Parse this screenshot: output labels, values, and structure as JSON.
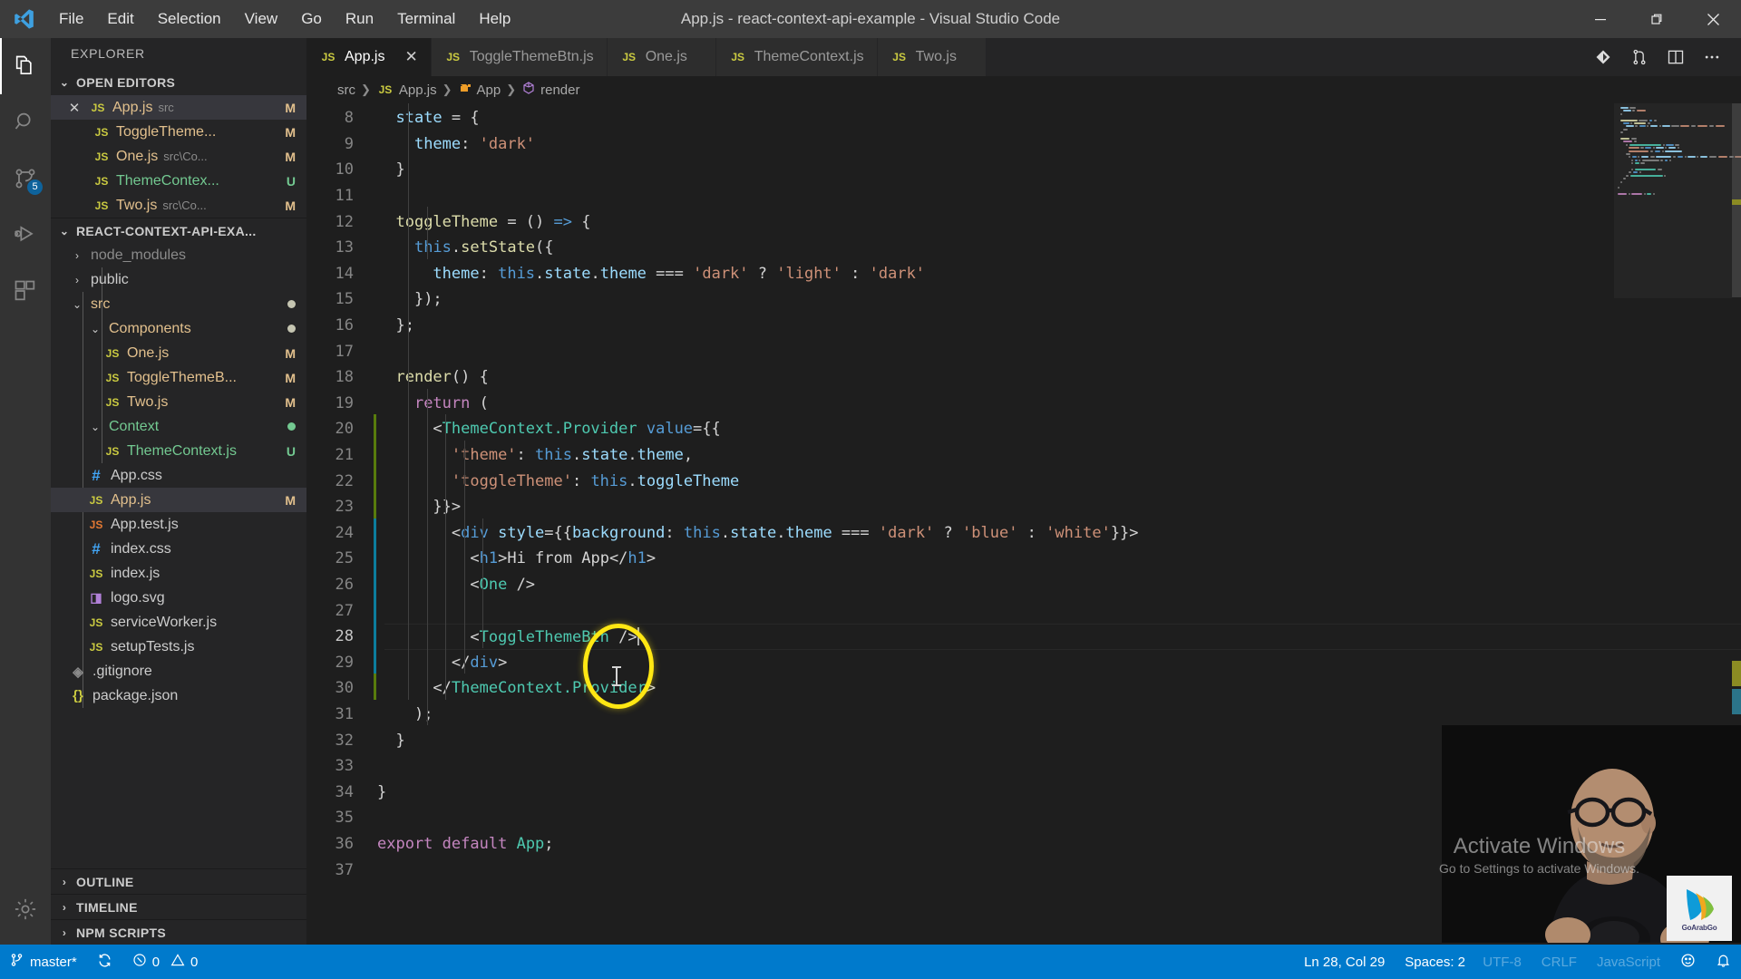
{
  "window": {
    "title": "App.js - react-context-api-example - Visual Studio Code",
    "logo_icon": "vscode-logo-icon",
    "minimize_icon": "minimize-icon",
    "maximize_icon": "maximize-restore-icon",
    "close_icon": "close-icon"
  },
  "menubar": {
    "items": [
      {
        "label": "File"
      },
      {
        "label": "Edit"
      },
      {
        "label": "Selection"
      },
      {
        "label": "View"
      },
      {
        "label": "Go"
      },
      {
        "label": "Run"
      },
      {
        "label": "Terminal"
      },
      {
        "label": "Help"
      }
    ]
  },
  "activitybar": {
    "items": [
      {
        "name": "explorer",
        "icon": "files-icon",
        "active": true,
        "badge": ""
      },
      {
        "name": "search",
        "icon": "search-icon",
        "active": false,
        "badge": ""
      },
      {
        "name": "source-control",
        "icon": "source-control-icon",
        "active": false,
        "badge": "5"
      },
      {
        "name": "run-and-debug",
        "icon": "run-debug-icon",
        "active": false,
        "badge": ""
      },
      {
        "name": "extensions",
        "icon": "extensions-icon",
        "active": false,
        "badge": ""
      }
    ],
    "settings": {
      "name": "manage",
      "icon": "gear-icon"
    }
  },
  "sidebar": {
    "title": "EXPLORER",
    "open_editors": {
      "header": "OPEN EDITORS",
      "expanded": true,
      "items": [
        {
          "icon": "js-file-icon",
          "name": "App.js",
          "path": "src",
          "badge": "M",
          "selected": true,
          "closeable": true,
          "state": "modified"
        },
        {
          "icon": "js-file-icon",
          "name": "ToggleTheme...",
          "path": "",
          "badge": "M",
          "selected": false,
          "closeable": false,
          "state": "modified"
        },
        {
          "icon": "js-file-icon",
          "name": "One.js",
          "path": "src\\Co...",
          "badge": "M",
          "selected": false,
          "closeable": false,
          "state": "modified"
        },
        {
          "icon": "js-file-icon",
          "name": "ThemeContex...",
          "path": "",
          "badge": "U",
          "selected": false,
          "closeable": false,
          "state": "new"
        },
        {
          "icon": "js-file-icon",
          "name": "Two.js",
          "path": "src\\Co...",
          "badge": "M",
          "selected": false,
          "closeable": false,
          "state": "modified"
        }
      ]
    },
    "workspace": {
      "header": "REACT-CONTEXT-API-EXA...",
      "expanded": true,
      "items": [
        {
          "depth": 0,
          "kind": "folder",
          "expanded": false,
          "icon": "chevron-right-icon",
          "name": "node_modules",
          "badge": "",
          "state": "dim"
        },
        {
          "depth": 0,
          "kind": "folder",
          "expanded": false,
          "icon": "chevron-right-icon",
          "name": "public",
          "badge": "",
          "state": ""
        },
        {
          "depth": 0,
          "kind": "folder",
          "expanded": true,
          "icon": "chevron-down-icon",
          "name": "src",
          "badge": "dot",
          "state": "modified"
        },
        {
          "depth": 1,
          "kind": "folder",
          "expanded": true,
          "icon": "chevron-down-icon",
          "name": "Components",
          "badge": "dot",
          "state": "modified"
        },
        {
          "depth": 2,
          "kind": "file",
          "icon": "js-file-icon",
          "name": "One.js",
          "badge": "M",
          "state": "modified"
        },
        {
          "depth": 2,
          "kind": "file",
          "icon": "js-file-icon",
          "name": "ToggleThemeB...",
          "badge": "M",
          "state": "modified"
        },
        {
          "depth": 2,
          "kind": "file",
          "icon": "js-file-icon",
          "name": "Two.js",
          "badge": "M",
          "state": "modified"
        },
        {
          "depth": 1,
          "kind": "folder",
          "expanded": true,
          "icon": "chevron-down-icon",
          "name": "Context",
          "badge": "dot-green",
          "state": "new"
        },
        {
          "depth": 2,
          "kind": "file",
          "icon": "js-file-icon",
          "name": "ThemeContext.js",
          "badge": "U",
          "state": "new"
        },
        {
          "depth": 1,
          "kind": "file",
          "icon": "css-file-icon",
          "name": "App.css",
          "badge": "",
          "state": ""
        },
        {
          "depth": 1,
          "kind": "file",
          "icon": "js-file-icon",
          "name": "App.js",
          "badge": "M",
          "state": "modified",
          "selected": true
        },
        {
          "depth": 1,
          "kind": "file",
          "icon": "js-test-file-icon",
          "name": "App.test.js",
          "badge": "",
          "state": ""
        },
        {
          "depth": 1,
          "kind": "file",
          "icon": "css-file-icon",
          "name": "index.css",
          "badge": "",
          "state": ""
        },
        {
          "depth": 1,
          "kind": "file",
          "icon": "js-file-icon",
          "name": "index.js",
          "badge": "",
          "state": ""
        },
        {
          "depth": 1,
          "kind": "file",
          "icon": "svg-file-icon",
          "name": "logo.svg",
          "badge": "",
          "state": ""
        },
        {
          "depth": 1,
          "kind": "file",
          "icon": "js-file-icon",
          "name": "serviceWorker.js",
          "badge": "",
          "state": ""
        },
        {
          "depth": 1,
          "kind": "file",
          "icon": "js-file-icon",
          "name": "setupTests.js",
          "badge": "",
          "state": ""
        },
        {
          "depth": 0,
          "kind": "file",
          "icon": "git-file-icon",
          "name": ".gitignore",
          "badge": "",
          "state": ""
        },
        {
          "depth": 0,
          "kind": "file",
          "icon": "json-file-icon",
          "name": "package.json",
          "badge": "",
          "state": ""
        }
      ]
    },
    "bottom_panes": [
      {
        "header": "OUTLINE",
        "expanded": false,
        "icon": "chevron-right-icon"
      },
      {
        "header": "TIMELINE",
        "expanded": false,
        "icon": "chevron-right-icon"
      },
      {
        "header": "NPM SCRIPTS",
        "expanded": false,
        "icon": "chevron-right-icon"
      }
    ]
  },
  "editor": {
    "tabs": [
      {
        "icon": "js-file-icon",
        "label": "App.js",
        "active": true,
        "close_icon": "close-icon"
      },
      {
        "icon": "js-file-icon",
        "label": "ToggleThemeBtn.js",
        "active": false,
        "close_icon": ""
      },
      {
        "icon": "js-file-icon",
        "label": "One.js",
        "active": false,
        "close_icon": ""
      },
      {
        "icon": "js-file-icon",
        "label": "ThemeContext.js",
        "active": false,
        "close_icon": ""
      },
      {
        "icon": "js-file-icon",
        "label": "Two.js",
        "active": false,
        "close_icon": ""
      }
    ],
    "actions": [
      {
        "name": "source-control-action",
        "icon": "git-compare-icon"
      },
      {
        "name": "run-file-action",
        "icon": "git-branch-icon"
      },
      {
        "name": "split-editor-action",
        "icon": "split-editor-icon"
      },
      {
        "name": "more-actions",
        "icon": "ellipsis-icon"
      }
    ],
    "breadcrumbs": [
      {
        "icon": "",
        "label": "src"
      },
      {
        "icon": "js-file-icon",
        "label": "App.js"
      },
      {
        "icon": "class-icon",
        "label": "App"
      },
      {
        "icon": "method-icon",
        "label": "render"
      }
    ],
    "first_visible_line": 8,
    "lines": [
      {
        "n": 8,
        "indent": 1,
        "tokens": [
          {
            "t": "state",
            "c": "t-var"
          },
          {
            "t": " = {",
            "c": "t-punc"
          }
        ]
      },
      {
        "n": 9,
        "indent": 2,
        "tokens": [
          {
            "t": "theme",
            "c": "t-prop"
          },
          {
            "t": ": ",
            "c": "t-punc"
          },
          {
            "t": "'dark'",
            "c": "t-str"
          }
        ]
      },
      {
        "n": 10,
        "indent": 1,
        "tokens": [
          {
            "t": "}",
            "c": "t-punc"
          }
        ]
      },
      {
        "n": 11,
        "indent": 0,
        "tokens": []
      },
      {
        "n": 12,
        "indent": 1,
        "tokens": [
          {
            "t": "toggleTheme",
            "c": "t-fn"
          },
          {
            "t": " = () ",
            "c": "t-punc"
          },
          {
            "t": "=>",
            "c": "t-kw2"
          },
          {
            "t": " {",
            "c": "t-punc"
          }
        ]
      },
      {
        "n": 13,
        "indent": 2,
        "tokens": [
          {
            "t": "this",
            "c": "t-this"
          },
          {
            "t": ".",
            "c": "t-punc"
          },
          {
            "t": "setState",
            "c": "t-fn"
          },
          {
            "t": "({",
            "c": "t-punc"
          }
        ]
      },
      {
        "n": 14,
        "indent": 3,
        "tokens": [
          {
            "t": "theme",
            "c": "t-prop"
          },
          {
            "t": ": ",
            "c": "t-punc"
          },
          {
            "t": "this",
            "c": "t-this"
          },
          {
            "t": ".",
            "c": "t-punc"
          },
          {
            "t": "state",
            "c": "t-var"
          },
          {
            "t": ".",
            "c": "t-punc"
          },
          {
            "t": "theme",
            "c": "t-var"
          },
          {
            "t": " === ",
            "c": "t-punc"
          },
          {
            "t": "'dark'",
            "c": "t-str"
          },
          {
            "t": " ? ",
            "c": "t-punc"
          },
          {
            "t": "'light'",
            "c": "t-str"
          },
          {
            "t": " : ",
            "c": "t-punc"
          },
          {
            "t": "'dark'",
            "c": "t-str"
          }
        ]
      },
      {
        "n": 15,
        "indent": 2,
        "tokens": [
          {
            "t": "});",
            "c": "t-punc"
          }
        ]
      },
      {
        "n": 16,
        "indent": 1,
        "tokens": [
          {
            "t": "};",
            "c": "t-punc"
          }
        ]
      },
      {
        "n": 17,
        "indent": 0,
        "tokens": []
      },
      {
        "n": 18,
        "indent": 1,
        "tokens": [
          {
            "t": "render",
            "c": "t-fn"
          },
          {
            "t": "() {",
            "c": "t-punc"
          }
        ]
      },
      {
        "n": 19,
        "indent": 2,
        "tokens": [
          {
            "t": "return",
            "c": "t-kw"
          },
          {
            "t": " (",
            "c": "t-punc"
          }
        ]
      },
      {
        "n": 20,
        "indent": 3,
        "tokens": [
          {
            "t": "<",
            "c": "t-punc"
          },
          {
            "t": "ThemeContext.Provider",
            "c": "t-tag"
          },
          {
            "t": " ",
            "c": "t-punc"
          },
          {
            "t": "value",
            "c": "t-tagb"
          },
          {
            "t": "={{",
            "c": "t-punc"
          }
        ]
      },
      {
        "n": 21,
        "indent": 4,
        "tokens": [
          {
            "t": "'theme'",
            "c": "t-str"
          },
          {
            "t": ": ",
            "c": "t-punc"
          },
          {
            "t": "this",
            "c": "t-this"
          },
          {
            "t": ".",
            "c": "t-punc"
          },
          {
            "t": "state",
            "c": "t-var"
          },
          {
            "t": ".",
            "c": "t-punc"
          },
          {
            "t": "theme",
            "c": "t-var"
          },
          {
            "t": ",",
            "c": "t-punc"
          }
        ]
      },
      {
        "n": 22,
        "indent": 4,
        "tokens": [
          {
            "t": "'toggleTheme'",
            "c": "t-str"
          },
          {
            "t": ": ",
            "c": "t-punc"
          },
          {
            "t": "this",
            "c": "t-this"
          },
          {
            "t": ".",
            "c": "t-punc"
          },
          {
            "t": "toggleTheme",
            "c": "t-var"
          }
        ]
      },
      {
        "n": 23,
        "indent": 3,
        "tokens": [
          {
            "t": "}}>",
            "c": "t-punc"
          }
        ]
      },
      {
        "n": 24,
        "indent": 4,
        "tokens": [
          {
            "t": "<",
            "c": "t-punc"
          },
          {
            "t": "div",
            "c": "t-tagb"
          },
          {
            "t": " ",
            "c": "t-punc"
          },
          {
            "t": "style",
            "c": "t-attr"
          },
          {
            "t": "={{",
            "c": "t-punc"
          },
          {
            "t": "background",
            "c": "t-prop"
          },
          {
            "t": ": ",
            "c": "t-punc"
          },
          {
            "t": "this",
            "c": "t-this"
          },
          {
            "t": ".",
            "c": "t-punc"
          },
          {
            "t": "state",
            "c": "t-var"
          },
          {
            "t": ".",
            "c": "t-punc"
          },
          {
            "t": "theme",
            "c": "t-var"
          },
          {
            "t": " === ",
            "c": "t-punc"
          },
          {
            "t": "'dark'",
            "c": "t-str"
          },
          {
            "t": " ? ",
            "c": "t-punc"
          },
          {
            "t": "'blue'",
            "c": "t-str"
          },
          {
            "t": " : ",
            "c": "t-punc"
          },
          {
            "t": "'white'",
            "c": "t-str"
          },
          {
            "t": "}}>",
            "c": "t-punc"
          }
        ]
      },
      {
        "n": 25,
        "indent": 5,
        "tokens": [
          {
            "t": "<",
            "c": "t-punc"
          },
          {
            "t": "h1",
            "c": "t-tagb"
          },
          {
            "t": ">",
            "c": "t-punc"
          },
          {
            "t": "Hi from App",
            "c": "t-punc"
          },
          {
            "t": "</",
            "c": "t-punc"
          },
          {
            "t": "h1",
            "c": "t-tagb"
          },
          {
            "t": ">",
            "c": "t-punc"
          }
        ]
      },
      {
        "n": 26,
        "indent": 5,
        "tokens": [
          {
            "t": "<",
            "c": "t-punc"
          },
          {
            "t": "One",
            "c": "t-tag"
          },
          {
            "t": " />",
            "c": "t-punc"
          }
        ]
      },
      {
        "n": 27,
        "indent": 0,
        "tokens": []
      },
      {
        "n": 28,
        "indent": 5,
        "current": true,
        "tokens": [
          {
            "t": "<",
            "c": "t-punc"
          },
          {
            "t": "ToggleThemeBtn",
            "c": "t-tag"
          },
          {
            "t": " />",
            "c": "t-punc"
          }
        ]
      },
      {
        "n": 29,
        "indent": 4,
        "tokens": [
          {
            "t": "</",
            "c": "t-punc"
          },
          {
            "t": "div",
            "c": "t-tagb"
          },
          {
            "t": ">",
            "c": "t-punc"
          }
        ]
      },
      {
        "n": 30,
        "indent": 3,
        "tokens": [
          {
            "t": "</",
            "c": "t-punc"
          },
          {
            "t": "ThemeContext.Provider",
            "c": "t-tag"
          },
          {
            "t": ">",
            "c": "t-punc"
          }
        ]
      },
      {
        "n": 31,
        "indent": 2,
        "tokens": [
          {
            "t": ");",
            "c": "t-punc"
          }
        ]
      },
      {
        "n": 32,
        "indent": 1,
        "tokens": [
          {
            "t": "}",
            "c": "t-punc"
          }
        ]
      },
      {
        "n": 33,
        "indent": 0,
        "tokens": []
      },
      {
        "n": 34,
        "indent": 0,
        "tokens": [
          {
            "t": "}",
            "c": "t-punc"
          }
        ]
      },
      {
        "n": 35,
        "indent": 0,
        "tokens": []
      },
      {
        "n": 36,
        "indent": 0,
        "tokens": [
          {
            "t": "export",
            "c": "t-kw"
          },
          {
            "t": " ",
            "c": "t-punc"
          },
          {
            "t": "default",
            "c": "t-kw"
          },
          {
            "t": " ",
            "c": "t-punc"
          },
          {
            "t": "App",
            "c": "t-cls"
          },
          {
            "t": ";",
            "c": "t-punc"
          }
        ]
      },
      {
        "n": 37,
        "indent": 0,
        "tokens": []
      }
    ]
  },
  "overlay": {
    "highlight_circle": {
      "name": "cursor-highlight-circle",
      "color": "#ffe713"
    },
    "watermark": {
      "line1": "Activate Windows",
      "line2": "Go to Settings to activate Windows."
    },
    "logo_label": "GoArabGo"
  },
  "statusbar": {
    "left": [
      {
        "name": "branch",
        "icon": "source-control-icon",
        "label": "master*"
      },
      {
        "name": "sync",
        "icon": "sync-icon",
        "label": ""
      },
      {
        "name": "problems",
        "icon": "error-icon",
        "label": "0",
        "icon2": "warning-icon",
        "label2": "0"
      }
    ],
    "right": [
      {
        "name": "cursor-position",
        "label": "Ln 28, Col 29"
      },
      {
        "name": "indentation",
        "label": "Spaces: 2"
      },
      {
        "name": "encoding",
        "label": "UTF-8"
      },
      {
        "name": "eol",
        "label": "CRLF"
      },
      {
        "name": "language-mode",
        "label": "JavaScript"
      },
      {
        "name": "feedback",
        "icon": "smiley-icon",
        "label": ""
      },
      {
        "name": "notifications",
        "icon": "bell-icon",
        "label": ""
      }
    ]
  },
  "colors": {
    "accent": "#007acc",
    "titlebar_bg": "#3c3c3c",
    "sidebar_bg": "#252526",
    "editor_bg": "#1e1e1e",
    "activitybar_bg": "#333333",
    "modified_badge": "#e2c08d",
    "new_badge": "#73c991",
    "highlight": "#ffe713"
  }
}
